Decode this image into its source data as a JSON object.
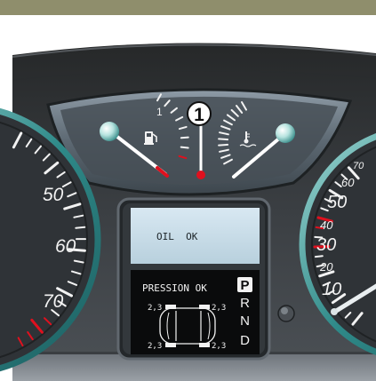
{
  "callout": {
    "number": "1"
  },
  "fuel_gauge": {
    "top_mark": "1"
  },
  "left_gauge": {
    "labels": [
      "50",
      "60",
      "70"
    ]
  },
  "right_gauge": {
    "labels": [
      "70",
      "60",
      "50",
      "40",
      "30",
      "20",
      "10"
    ],
    "red_labels": [
      "50",
      "30"
    ]
  },
  "display": {
    "oil_message": "OIL  OK",
    "pressure_message": "PRESSION OK",
    "tyre_values": [
      "2,3",
      "2,3",
      "2,3",
      "2,3"
    ],
    "gear_letters": [
      "P",
      "R",
      "N",
      "D"
    ],
    "selected_gear": "P"
  },
  "icons": [
    "fuel-pump-icon",
    "coolant-temperature-icon"
  ],
  "colors": {
    "accent_red": "#e0101e",
    "chrome_teal": "#3a8c8c",
    "lcd_top": "#cfe1ec",
    "header_bar": "#8f8e6c",
    "dash_dark": "#2e3134"
  }
}
